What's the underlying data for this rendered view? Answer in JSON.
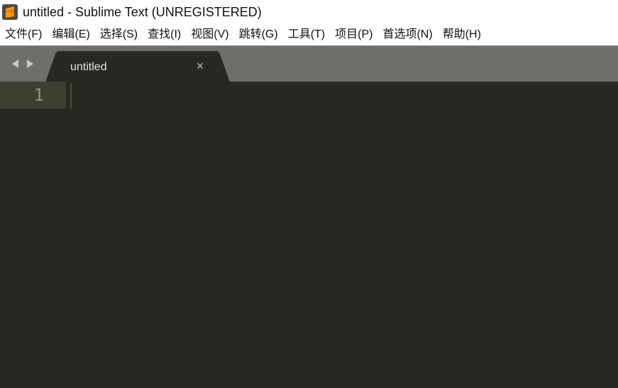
{
  "window": {
    "title": "untitled - Sublime Text (UNREGISTERED)",
    "icon": "sublime-text-logo-icon"
  },
  "menu": {
    "items": [
      {
        "label": "文件(F)"
      },
      {
        "label": "编辑(E)"
      },
      {
        "label": "选择(S)"
      },
      {
        "label": "查找(I)"
      },
      {
        "label": "视图(V)"
      },
      {
        "label": "跳转(G)"
      },
      {
        "label": "工具(T)"
      },
      {
        "label": "项目(P)"
      },
      {
        "label": "首选项(N)"
      },
      {
        "label": "帮助(H)"
      }
    ]
  },
  "tabs": {
    "nav_icons": [
      "left-arrow-icon",
      "right-arrow-icon"
    ],
    "items": [
      {
        "label": "untitled",
        "close_glyph": "×",
        "active": true
      }
    ]
  },
  "editor": {
    "line_numbers": [
      "1"
    ],
    "content": ""
  },
  "colors": {
    "editor_bg": "#272822",
    "tabstrip_bg": "#6e6e6b",
    "active_tab_bg": "#272822",
    "brand_orange": "#ff9800"
  }
}
